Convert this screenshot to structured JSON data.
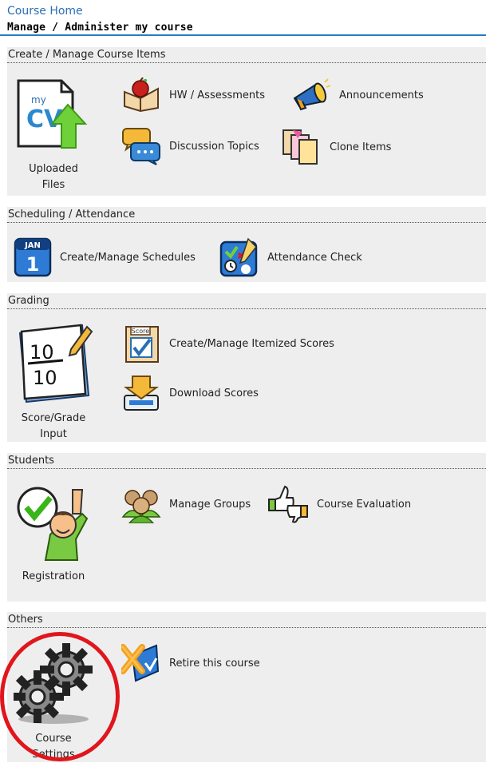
{
  "breadcrumb": "Course Home",
  "page_title": "Manage / Administer my course",
  "sections": {
    "create": {
      "title": "Create / Manage Course Items",
      "tile": {
        "label_line1": "Uploaded",
        "label_line2": "Files",
        "icon": "uploaded-files-icon",
        "logo_text": "my",
        "logo_letters": "CV"
      },
      "items": [
        {
          "label": "HW / Assessments",
          "icon": "apple-book-icon"
        },
        {
          "label": "Announcements",
          "icon": "megaphone-icon"
        },
        {
          "label": "Discussion Topics",
          "icon": "chat-bubbles-icon"
        },
        {
          "label": "Clone Items",
          "icon": "copy-documents-icon"
        }
      ]
    },
    "scheduling": {
      "title": "Scheduling / Attendance",
      "items": [
        {
          "label": "Create/Manage Schedules",
          "icon": "calendar-icon",
          "cal_month": "JAN",
          "cal_day": "1"
        },
        {
          "label": "Attendance Check",
          "icon": "attendance-icon"
        }
      ]
    },
    "grading": {
      "title": "Grading",
      "tile": {
        "label_line1": "Score/Grade",
        "label_line2": "Input",
        "icon": "score-pad-icon",
        "top_num": "10",
        "bottom_num": "10"
      },
      "items": [
        {
          "label": "Create/Manage Itemized Scores",
          "icon": "score-checkbox-icon",
          "badge": "Score"
        },
        {
          "label": "Download Scores",
          "icon": "download-tray-icon"
        }
      ]
    },
    "students": {
      "title": "Students",
      "tile": {
        "label": "Registration",
        "icon": "registration-icon"
      },
      "items": [
        {
          "label": "Manage Groups",
          "icon": "group-icon"
        },
        {
          "label": "Course Evaluation",
          "icon": "thumbs-icon"
        }
      ]
    },
    "others": {
      "title": "Others",
      "tile": {
        "label_line1": "Course",
        "label_line2": "Settings",
        "icon": "gears-icon"
      },
      "items": [
        {
          "label": "Retire this course",
          "icon": "retire-icon"
        }
      ]
    }
  },
  "colors": {
    "link": "#2a6fb5",
    "rule": "#2c7bbf",
    "highlight_ring": "#e0161c",
    "section_bg": "#eeeeee"
  }
}
